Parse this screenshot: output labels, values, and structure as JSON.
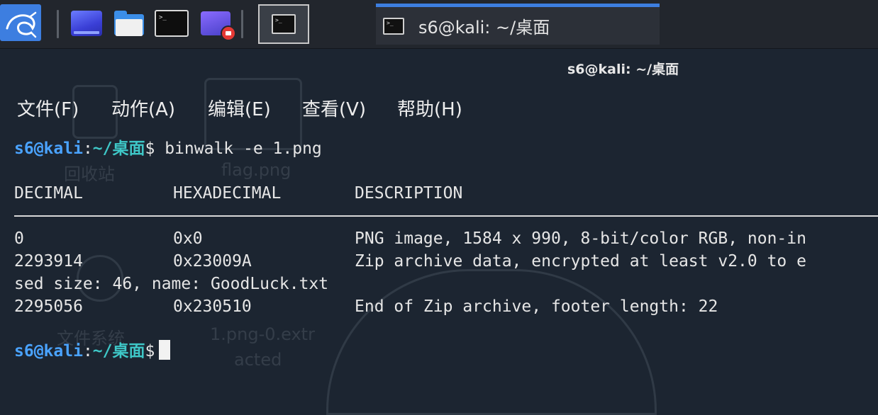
{
  "taskbar": {
    "icons": [
      "kali-dragon-icon",
      "desktop-icon",
      "file-manager-icon",
      "terminal-icon",
      "screen-recorder-icon"
    ],
    "active_window_icon": "terminal-icon",
    "task_title": "s6@kali: ~/桌面",
    "accent_color": "#3d7ee0"
  },
  "window": {
    "title": "s6@kali: ~/桌面"
  },
  "menubar": {
    "file": "文件(F)",
    "action": "动作(A)",
    "edit": "编辑(E)",
    "view": "查看(V)",
    "help": "帮助(H)"
  },
  "desktop_ghosts": {
    "trash": "回收站",
    "flag": "flag.png",
    "filesystem": "文件系统",
    "extracted_line1": "1.png-0.extr",
    "extracted_line2": "acted"
  },
  "terminal": {
    "prompt_user": "s6@kali",
    "prompt_sep": ":",
    "prompt_path": "~/桌面",
    "prompt_symbol": "$",
    "command": " binwalk -e 1.png",
    "headers": {
      "decimal": "DECIMAL",
      "hex": "HEXADECIMAL",
      "desc": "DESCRIPTION"
    },
    "rows": [
      {
        "decimal": "0",
        "hex": "0x0",
        "desc": "PNG image, 1584 x 990, 8-bit/color RGB, non-in"
      },
      {
        "decimal": "2293914",
        "hex": "0x23009A",
        "desc": "Zip archive data, encrypted at least v2.0 to e"
      },
      {
        "decimal": "",
        "hex": "",
        "desc": "",
        "wrap": "sed size: 46, name: GoodLuck.txt"
      },
      {
        "decimal": "2295056",
        "hex": "0x230510",
        "desc": "End of Zip archive, footer length: 22"
      }
    ],
    "colors": {
      "user": "#4aa3ff",
      "path": "#3ec7c7",
      "background": "#1c2531"
    }
  }
}
